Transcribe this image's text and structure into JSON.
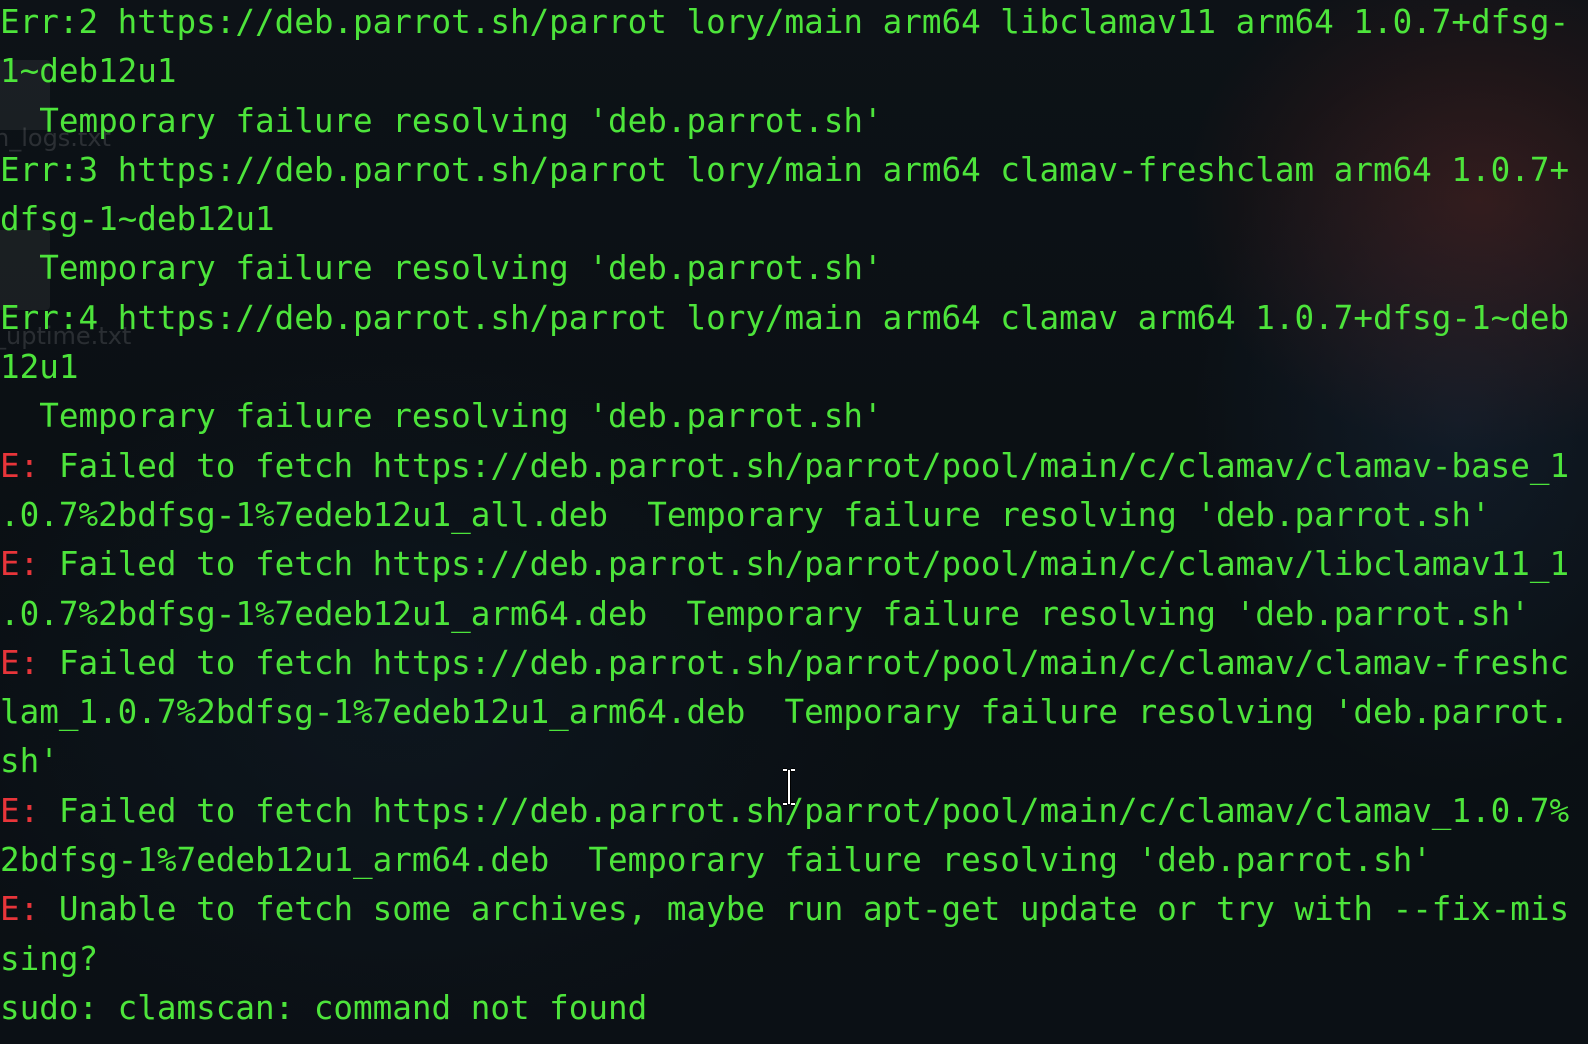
{
  "desktop": {
    "icons": [
      {
        "label": "n_logs.txt"
      },
      {
        "label": "_uptime.txt"
      }
    ]
  },
  "terminal": {
    "colors": {
      "text": "#4de43b",
      "error_prefix": "#e8353a",
      "background": "#0b1014"
    },
    "lines": [
      {
        "prefix": "",
        "text": "Err:2 https://deb.parrot.sh/parrot lory/main arm64 libclamav11 arm64 1.0.7+dfsg-"
      },
      {
        "prefix": "",
        "text": "1~deb12u1"
      },
      {
        "prefix": "",
        "text": "  Temporary failure resolving 'deb.parrot.sh'"
      },
      {
        "prefix": "",
        "text": "Err:3 https://deb.parrot.sh/parrot lory/main arm64 clamav-freshclam arm64 1.0.7+"
      },
      {
        "prefix": "",
        "text": "dfsg-1~deb12u1"
      },
      {
        "prefix": "",
        "text": "  Temporary failure resolving 'deb.parrot.sh'"
      },
      {
        "prefix": "",
        "text": "Err:4 https://deb.parrot.sh/parrot lory/main arm64 clamav arm64 1.0.7+dfsg-1~deb"
      },
      {
        "prefix": "",
        "text": "12u1"
      },
      {
        "prefix": "",
        "text": "  Temporary failure resolving 'deb.parrot.sh'"
      },
      {
        "prefix": "E:",
        "text": " Failed to fetch https://deb.parrot.sh/parrot/pool/main/c/clamav/clamav-base_1"
      },
      {
        "prefix": "",
        "text": ".0.7%2bdfsg-1%7edeb12u1_all.deb  Temporary failure resolving 'deb.parrot.sh'"
      },
      {
        "prefix": "E:",
        "text": " Failed to fetch https://deb.parrot.sh/parrot/pool/main/c/clamav/libclamav11_1"
      },
      {
        "prefix": "",
        "text": ".0.7%2bdfsg-1%7edeb12u1_arm64.deb  Temporary failure resolving 'deb.parrot.sh'"
      },
      {
        "prefix": "E:",
        "text": " Failed to fetch https://deb.parrot.sh/parrot/pool/main/c/clamav/clamav-freshc"
      },
      {
        "prefix": "",
        "text": "lam_1.0.7%2bdfsg-1%7edeb12u1_arm64.deb  Temporary failure resolving 'deb.parrot."
      },
      {
        "prefix": "",
        "text": "sh'"
      },
      {
        "prefix": "E:",
        "text": " Failed to fetch https://deb.parrot.sh/parrot/pool/main/c/clamav/clamav_1.0.7%"
      },
      {
        "prefix": "",
        "text": "2bdfsg-1%7edeb12u1_arm64.deb  Temporary failure resolving 'deb.parrot.sh'"
      },
      {
        "prefix": "E:",
        "text": " Unable to fetch some archives, maybe run apt-get update or try with --fix-mis"
      },
      {
        "prefix": "",
        "text": "sing?"
      },
      {
        "prefix": "",
        "text": "sudo: clamscan: command not found"
      }
    ]
  }
}
